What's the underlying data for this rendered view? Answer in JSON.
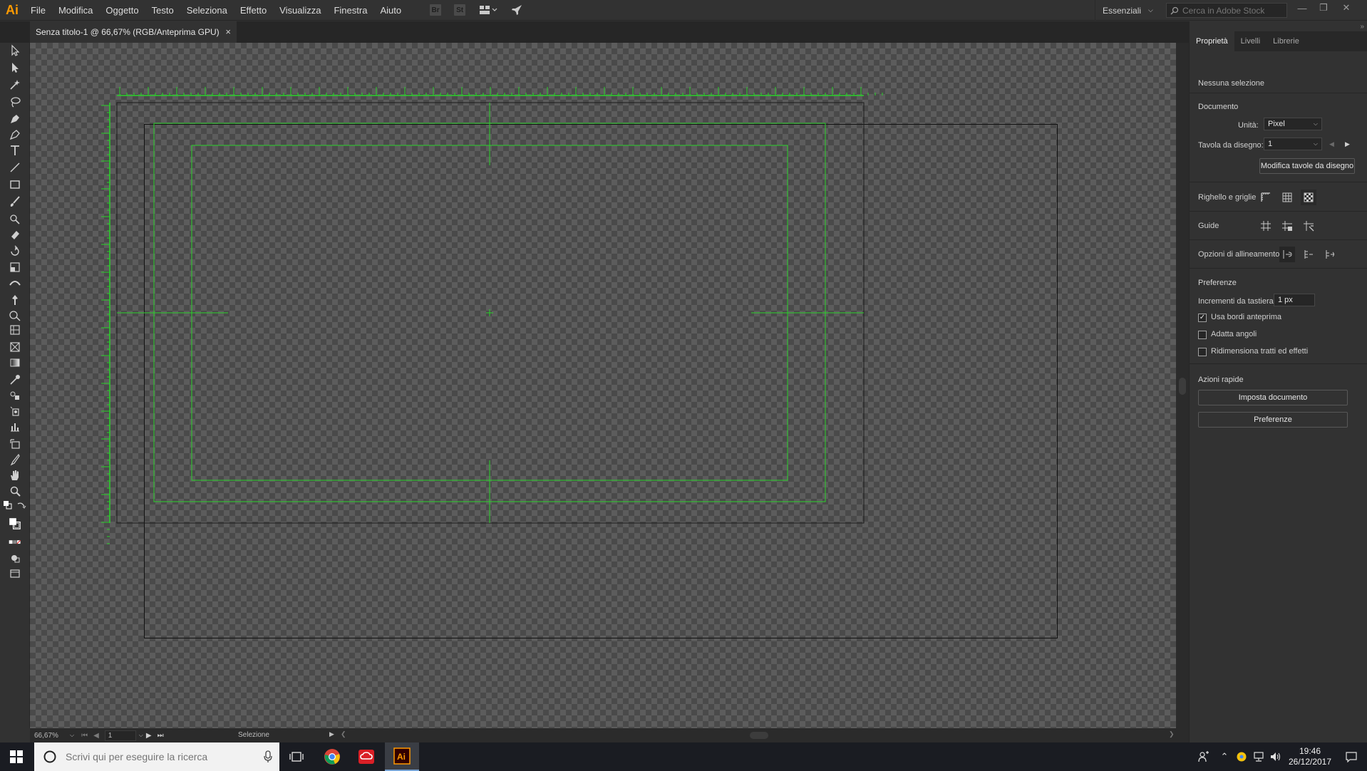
{
  "app": {
    "logo": "Ai",
    "menu": [
      "File",
      "Modifica",
      "Oggetto",
      "Testo",
      "Seleziona",
      "Effetto",
      "Visualizza",
      "Finestra",
      "Aiuto"
    ],
    "bridge_label": "Br",
    "stock_label": "St",
    "workspace": "Essenziali",
    "stock_search_placeholder": "Cerca in Adobe Stock"
  },
  "document": {
    "tab_title": "Senza titolo-1 @ 66,67% (RGB/Anteprima GPU)",
    "close_glyph": "×"
  },
  "statusbar": {
    "zoom": "66,67%",
    "artboard_number": "1",
    "status": "Selezione"
  },
  "properties_panel": {
    "tabs": [
      "Proprietà",
      "Livelli",
      "Librerie"
    ],
    "selection_info": "Nessuna selezione",
    "document_section": "Documento",
    "units_label": "Unità:",
    "units_value": "Pixel",
    "artboard_label": "Tavola da disegno:",
    "artboard_value": "1",
    "edit_artboards_button": "Modifica tavole da disegno",
    "rulers_grids_label": "Righello e griglie",
    "guides_label": "Guide",
    "snap_options_label": "Opzioni di allineamento",
    "preferences_section": "Preferenze",
    "keyboard_increment_label": "Incrementi da tastiera:",
    "keyboard_increment_value": "1 px",
    "checkboxes": [
      {
        "label": "Usa bordi anteprima",
        "checked": true
      },
      {
        "label": "Adatta angoli",
        "checked": false
      },
      {
        "label": "Ridimensiona tratti ed effetti",
        "checked": false
      }
    ],
    "quick_actions_section": "Azioni rapide",
    "document_setup_button": "Imposta documento",
    "preferences_button": "Preferenze"
  },
  "taskbar": {
    "search_placeholder": "Scrivi qui per eseguire la ricerca",
    "time": "19:46",
    "date": "26/12/2017"
  },
  "colors": {
    "accent_guides": "#2ad12a",
    "illustrator_orange": "#ff9a00",
    "panel_bg": "#323232"
  }
}
